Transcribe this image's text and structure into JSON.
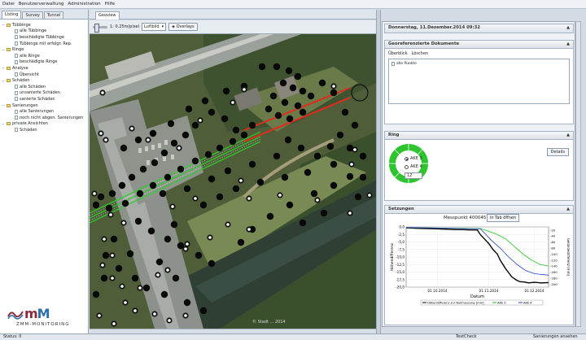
{
  "menu": [
    "Datei",
    "Benutzerverwaltung",
    "Administration",
    "Hilfe"
  ],
  "left": {
    "tabs": [
      "Listing",
      "Survey",
      "Tunnel"
    ],
    "tree": [
      {
        "label": "Tübbinge",
        "level": 0,
        "type": "folder"
      },
      {
        "label": "alle Tübbinge",
        "level": 1,
        "type": "doc"
      },
      {
        "label": "beschädigte Tübbinge",
        "level": 1,
        "type": "doc"
      },
      {
        "label": "Tübbinge mit erfolgr. Rep.",
        "level": 1,
        "type": "doc"
      },
      {
        "label": "Ringe",
        "level": 0,
        "type": "folder"
      },
      {
        "label": "alle Ringe",
        "level": 1,
        "type": "doc"
      },
      {
        "label": "beschädigte Ringe",
        "level": 1,
        "type": "doc"
      },
      {
        "label": "Analyse",
        "level": 0,
        "type": "folder"
      },
      {
        "label": "Übersicht",
        "level": 1,
        "type": "doc"
      },
      {
        "label": "Schäden",
        "level": 0,
        "type": "folder"
      },
      {
        "label": "alle Schäden",
        "level": 1,
        "type": "doc"
      },
      {
        "label": "unsanierte Schäden",
        "level": 1,
        "type": "doc"
      },
      {
        "label": "sanierte Schäden",
        "level": 1,
        "type": "doc"
      },
      {
        "label": "Sanierungen",
        "level": 0,
        "type": "folder"
      },
      {
        "label": "alle Sanierungen",
        "level": 1,
        "type": "doc"
      },
      {
        "label": "noch nicht abgen. Sanierungen",
        "level": 1,
        "type": "doc"
      },
      {
        "label": "private Ansichten",
        "level": 0,
        "type": "folder"
      },
      {
        "label": "Schäden",
        "level": 1,
        "type": "doc"
      }
    ],
    "logo_text": "ZMM-MONITORING"
  },
  "map": {
    "tab": "Geoview",
    "scale": "1: 0.25m/pixel",
    "layer_select": "Luftbild",
    "overlays_label": "Overlays",
    "watermark": "© Stadt ... 2014"
  },
  "right": {
    "date_header": "Donnerstag, 11.Dezember.2014 09:32",
    "geo_docs": {
      "title": "Georeferenzierte Dokumente",
      "links": [
        "Überblick",
        "Löschen"
      ],
      "list_items": [
        "alle Punkte"
      ]
    },
    "ring": {
      "title": "Ring",
      "details_label": "Details",
      "options": [
        {
          "label": "AKE 3",
          "selected": true
        },
        {
          "label": "AKE 4",
          "selected": false
        }
      ],
      "input_value": "12",
      "ring_color": "#2ec42e"
    },
    "setzungen": {
      "title": "Setzungen",
      "messpunkt": "Messpunkt 400045",
      "open_tab_label": "in Tab öffnen"
    }
  },
  "status": {
    "left": "Status: 0",
    "mid": "TextCheck",
    "right": "Sanierungen ansehen"
  },
  "chart_data": {
    "type": "line",
    "xlabel": "Datum",
    "ylabel": "Höhendifferenz",
    "y2label": "Geländedifferenz [mm]",
    "xticks": [
      "01.10.2014",
      "01.11.2014",
      "01.12.2014"
    ],
    "yticks": [
      "0,0",
      "-2,5",
      "-5,0",
      "-7,5",
      "-10,0",
      "-12,5",
      "-15,0",
      "-17,5",
      "-20,0"
    ],
    "y2ticks": [
      "-20",
      "-40",
      "-60",
      "-80",
      "-100",
      "-120",
      "-140",
      "-160",
      "-180",
      "-200"
    ],
    "ylim": [
      -20,
      0
    ],
    "legend": [
      "Höhendifferenz zur Nullmessung [mm]",
      "AKE 3",
      "AKE 4"
    ],
    "series": [
      {
        "name": "Höhendifferenz zur Nullmessung [mm]",
        "color": "#000000",
        "x": [
          0,
          10,
          20,
          30,
          35,
          40,
          45,
          50,
          52,
          55,
          58,
          61,
          64,
          66,
          68,
          70,
          72,
          74,
          76,
          78,
          80,
          83,
          86,
          90,
          95,
          100
        ],
        "y": [
          -0.3,
          -0.5,
          -0.6,
          -0.8,
          -0.9,
          -0.9,
          -1.0,
          -1.0,
          -2.5,
          -4.0,
          -5.5,
          -7.5,
          -9.0,
          -11.0,
          -12.5,
          -14.0,
          -15.2,
          -16.5,
          -17.2,
          -17.8,
          -18.2,
          -18.3,
          -18.6,
          -18.4,
          -18.6,
          -18.5
        ]
      },
      {
        "name": "AKE 3",
        "color": "#1ec41e",
        "x": [
          0,
          52,
          58,
          64,
          70,
          76,
          82,
          88,
          94,
          100
        ],
        "y": [
          -0.2,
          -0.5,
          -1.5,
          -2.5,
          -4.0,
          -6.5,
          -9.0,
          -11.0,
          -12.5,
          -13.0
        ]
      },
      {
        "name": "AKE 4",
        "color": "#2040c0",
        "x": [
          0,
          52,
          56,
          60,
          66,
          72,
          78,
          84,
          90,
          95,
          100
        ],
        "y": [
          -0.2,
          -0.6,
          -2.5,
          -4.5,
          -7.0,
          -10.0,
          -12.5,
          -14.5,
          -15.5,
          -15.8,
          -16.0
        ]
      }
    ]
  }
}
